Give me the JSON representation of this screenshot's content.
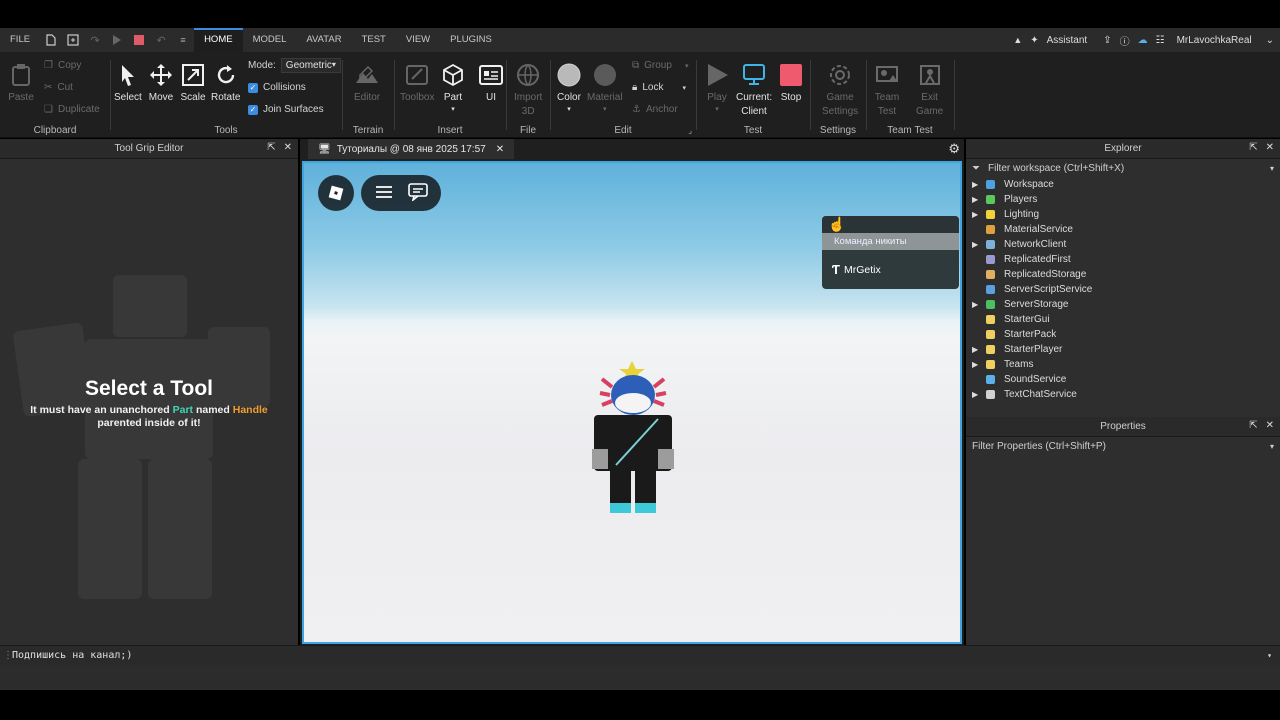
{
  "menubar": {
    "file": "FILE",
    "tabs": [
      {
        "label": "HOME",
        "active": true
      },
      {
        "label": "MODEL"
      },
      {
        "label": "AVATAR"
      },
      {
        "label": "TEST"
      },
      {
        "label": "VIEW"
      },
      {
        "label": "PLUGINS"
      }
    ],
    "assistant": "Assistant",
    "username": "MrLavochkaReal"
  },
  "ribbon": {
    "clipboard": {
      "label": "Clipboard",
      "paste": "Paste",
      "copy": "Copy",
      "cut": "Cut",
      "duplicate": "Duplicate"
    },
    "tools": {
      "label": "Tools",
      "select": "Select",
      "move": "Move",
      "scale": "Scale",
      "rotate": "Rotate",
      "mode_label": "Mode:",
      "mode_value": "Geometric",
      "collisions": "Collisions",
      "join_surfaces": "Join Surfaces"
    },
    "terrain": {
      "label": "Terrain",
      "editor": "Editor"
    },
    "insert": {
      "label": "Insert",
      "toolbox": "Toolbox",
      "part": "Part",
      "ui": "UI"
    },
    "file": {
      "label": "File",
      "import_3d_line1": "Import",
      "import_3d_line2": "3D"
    },
    "edit": {
      "label": "Edit",
      "color": "Color",
      "material": "Material",
      "group": "Group",
      "lock": "Lock",
      "anchor": "Anchor"
    },
    "test": {
      "label": "Test",
      "play": "Play",
      "current_line1": "Current:",
      "current_line2": "Client",
      "stop": "Stop"
    },
    "settings": {
      "label": "Settings",
      "game_settings_line1": "Game",
      "game_settings_line2": "Settings"
    },
    "team_test": {
      "label": "Team Test",
      "team_test_line1": "Team",
      "team_test_line2": "Test",
      "exit_game_line1": "Exit",
      "exit_game_line2": "Game"
    }
  },
  "left_panel": {
    "title": "Tool Grip Editor",
    "heading": "Select a Tool",
    "sub_1": "It must have an unanchored ",
    "sub_part": "Part",
    "sub_2": " named ",
    "sub_handle": "Handle",
    "sub_3": " parented inside of it!"
  },
  "viewport": {
    "tab_title": "Туториалы @ 08 янв 2025 17:57",
    "team_name": "Команда никиты",
    "player_name": "MrGetix"
  },
  "explorer": {
    "title": "Explorer",
    "filter_placeholder": "Filter workspace (Ctrl+Shift+X)",
    "items": [
      {
        "label": "Workspace",
        "expandable": true,
        "icon": "globe-icon",
        "color": "#4aa3e0"
      },
      {
        "label": "Players",
        "expandable": true,
        "icon": "players-icon",
        "color": "#5ac85a"
      },
      {
        "label": "Lighting",
        "expandable": true,
        "icon": "lightbulb-icon",
        "color": "#f2d23a"
      },
      {
        "label": "MaterialService",
        "expandable": false,
        "icon": "material-icon",
        "color": "#e0a040"
      },
      {
        "label": "NetworkClient",
        "expandable": true,
        "icon": "network-icon",
        "color": "#7fb0d8"
      },
      {
        "label": "ReplicatedFirst",
        "expandable": false,
        "icon": "replicated-icon",
        "color": "#9a9ad0"
      },
      {
        "label": "ReplicatedStorage",
        "expandable": false,
        "icon": "storage-icon",
        "color": "#e0b060"
      },
      {
        "label": "ServerScriptService",
        "expandable": false,
        "icon": "script-service-icon",
        "color": "#5aa0e0"
      },
      {
        "label": "ServerStorage",
        "expandable": true,
        "icon": "server-storage-icon",
        "color": "#4ac060"
      },
      {
        "label": "StarterGui",
        "expandable": false,
        "icon": "folder-icon",
        "color": "#f0d060"
      },
      {
        "label": "StarterPack",
        "expandable": false,
        "icon": "folder-icon",
        "color": "#f0d060"
      },
      {
        "label": "StarterPlayer",
        "expandable": true,
        "icon": "folder-icon",
        "color": "#f0d060"
      },
      {
        "label": "Teams",
        "expandable": true,
        "icon": "teams-icon",
        "color": "#f0d060"
      },
      {
        "label": "SoundService",
        "expandable": false,
        "icon": "sound-icon",
        "color": "#5ab0e8"
      },
      {
        "label": "TextChatService",
        "expandable": true,
        "icon": "chat-icon",
        "color": "#d0d0d0"
      }
    ]
  },
  "properties": {
    "title": "Properties",
    "filter_placeholder": "Filter Properties (Ctrl+Shift+P)"
  },
  "command_bar": {
    "value": "Подпишись на канал;)"
  }
}
